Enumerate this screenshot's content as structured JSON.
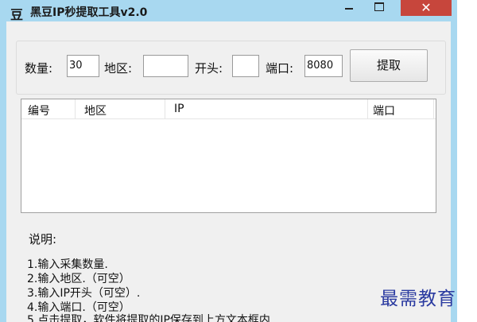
{
  "window": {
    "icon_glyph": "豆",
    "title": "黑豆IP秒提取工具v2.0",
    "controls": {
      "close_glyph": "✕"
    }
  },
  "form": {
    "count_label": "数量:",
    "count_value": "30",
    "region_label": "地区:",
    "region_value": "",
    "prefix_label": "开头:",
    "prefix_value": "",
    "port_label": "端口:",
    "port_value": "8080",
    "fetch_button": "提取"
  },
  "list": {
    "columns": [
      "编号",
      "地区",
      "IP",
      "端口"
    ],
    "rows": []
  },
  "notes": {
    "title": "说明:",
    "items": [
      "1.输入采集数量.",
      "2.输入地区.（可空）",
      "3.输入IP开头（可空）.",
      "4.输入端口.（可空）",
      "5.点击提取，软件将提取的IP保存到上方文本框内"
    ]
  },
  "watermark": "最需教育"
}
